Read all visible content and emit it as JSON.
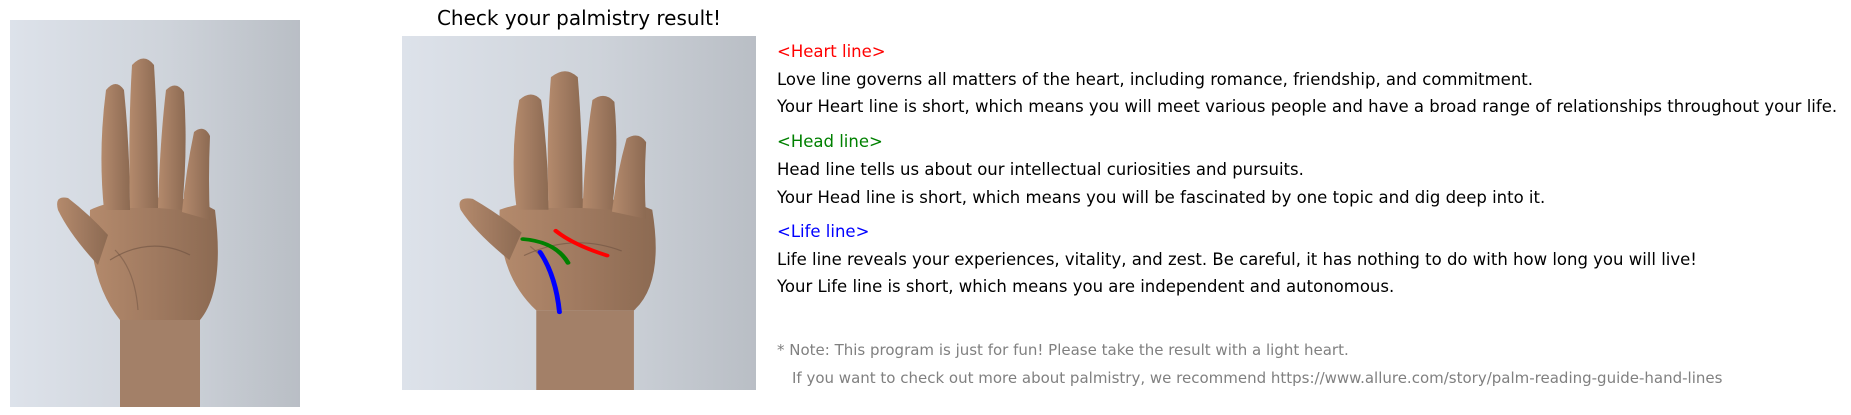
{
  "title": "Check your palmistry result!",
  "colors": {
    "heart": "#ff0000",
    "head": "#008000",
    "life": "#0000ff",
    "note": "#808080"
  },
  "sections": [
    {
      "heading": "<Heart line>",
      "color": "#ff0000",
      "description": "Love line governs all matters of the heart, including romance, friendship, and commitment.",
      "result": "Your Heart line is short, which means you will meet various people and have a broad range of relationships throughout your life."
    },
    {
      "heading": "<Head line>",
      "color": "#008000",
      "description": "Head line tells us about our intellectual curiosities and pursuits.",
      "result": "Your Head line is short, which means you will be fascinated by one topic and dig deep into it."
    },
    {
      "heading": "<Life line>",
      "color": "#0000ff",
      "description": "Life line reveals your experiences, vitality, and zest. Be careful, it has nothing to do with how long you will live!",
      "result": "Your Life line is short, which means you are independent and autonomous."
    }
  ],
  "note": {
    "line1": "* Note: This program is just for fun! Please take the result with a light heart.",
    "line2": "If you want to check out more about palmistry, we recommend https://www.allure.com/story/palm-reading-guide-hand-lines"
  }
}
